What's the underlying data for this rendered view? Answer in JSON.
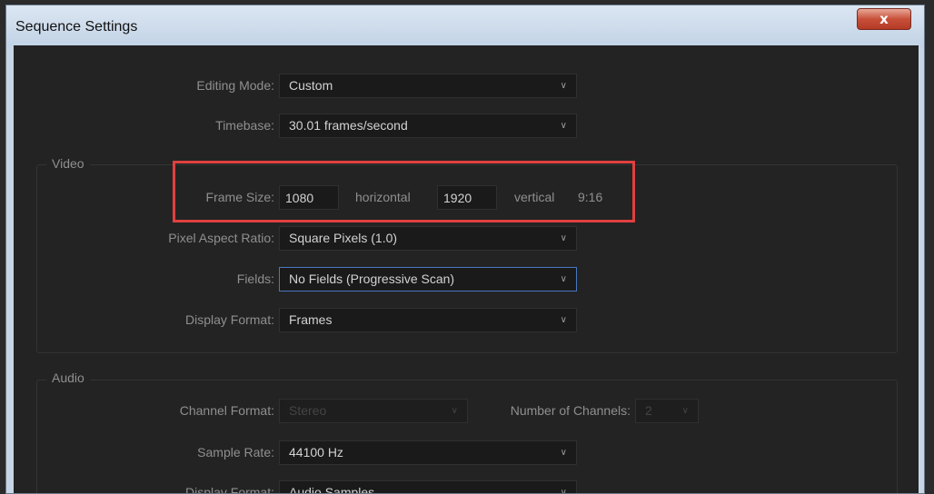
{
  "window": {
    "title": "Sequence Settings",
    "close_label": "x"
  },
  "editing_mode": {
    "label": "Editing Mode:",
    "value": "Custom"
  },
  "timebase": {
    "label": "Timebase:",
    "value": "30.01  frames/second"
  },
  "video": {
    "title": "Video",
    "frame_size": {
      "label": "Frame Size:",
      "horizontal_value": "1080",
      "horizontal_label": "horizontal",
      "vertical_value": "1920",
      "vertical_label": "vertical",
      "ratio": "9:16"
    },
    "pixel_aspect_ratio": {
      "label": "Pixel Aspect Ratio:",
      "value": "Square Pixels (1.0)"
    },
    "fields": {
      "label": "Fields:",
      "value": "No Fields (Progressive Scan)"
    },
    "display_format": {
      "label": "Display Format:",
      "value": "Frames"
    }
  },
  "audio": {
    "title": "Audio",
    "channel_format": {
      "label": "Channel Format:",
      "value": "Stereo"
    },
    "number_of_channels": {
      "label": "Number of Channels:",
      "value": "2"
    },
    "sample_rate": {
      "label": "Sample Rate:",
      "value": "44100 Hz"
    },
    "display_format": {
      "label": "Display Format:",
      "value": "Audio Samples"
    }
  },
  "colors": {
    "highlight": "#e04040",
    "focus": "#4a78c2",
    "close_button": "#c8503a"
  }
}
